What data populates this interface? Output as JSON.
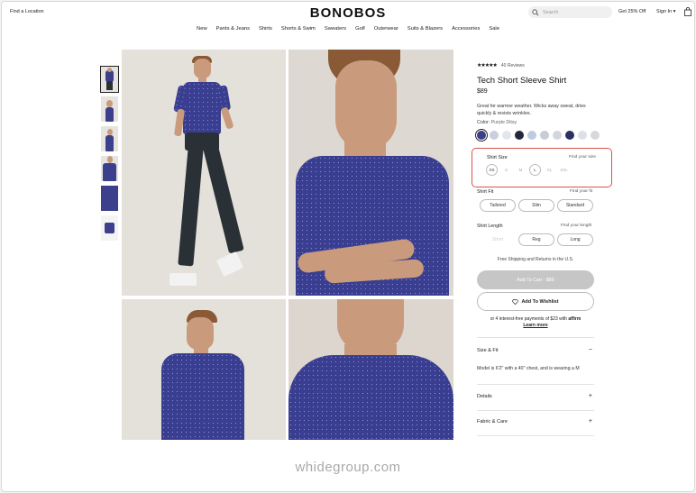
{
  "header": {
    "find_location": "Find a Location",
    "logo": "BONOBOS",
    "search_placeholder": "Search",
    "promo": "Get 25% Off",
    "sign_in": "Sign In ▾"
  },
  "nav": [
    "New",
    "Pants & Jeans",
    "Shirts",
    "Shorts & Swim",
    "Sweaters",
    "Golf",
    "Outerwear",
    "Suits & Blazers",
    "Accessories",
    "Sale"
  ],
  "product": {
    "stars": "★★★★★",
    "reviews": "40 Reviews",
    "title": "Tech Short Sleeve Shirt",
    "price": "$89",
    "description": "Great for warmer weather. Wicks away sweat, dries quickly & resists wrinkles.",
    "color_label": "Color:",
    "color_value": "Purple Ditsy",
    "swatch_colors": [
      "#3a3e8c",
      "#c9cfe0",
      "#e3e6ec",
      "#23263d",
      "#bccbe0",
      "#c8ccd4",
      "#d3d6da",
      "#2d3162",
      "#dde0e6",
      "#d6d8dc"
    ],
    "shirt_size": {
      "label": "Shirt Size",
      "find": "Find your size",
      "sizes": [
        "XS",
        "S",
        "M",
        "L",
        "XL",
        "XXL"
      ]
    },
    "shirt_fit": {
      "label": "Shirt Fit",
      "find": "Find your fit",
      "options": [
        "Tailored",
        "Slim",
        "Standard"
      ]
    },
    "shirt_length": {
      "label": "Shirt Length",
      "find": "Find your length",
      "options": [
        "Short",
        "Reg",
        "Long"
      ]
    },
    "shipping": "Free Shipping and Returns in the U.S.",
    "add_to_cart": "Add To Cart - $89",
    "wishlist": "Add To Wishlist",
    "affirm_text": "or 4 interest-free payments of $23 with",
    "affirm_brand": "affirm",
    "learn_more": "Learn more"
  },
  "accordion": {
    "size_fit": "Size & Fit",
    "model_text": "Model is 6'2\" with a 40\" chest, and is wearing a M",
    "details": "Details",
    "fabric": "Fabric & Care"
  },
  "watermark": "whidegroup.com"
}
